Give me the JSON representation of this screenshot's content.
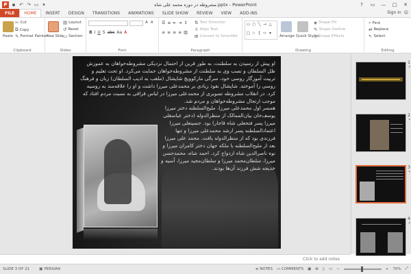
{
  "window": {
    "title": "مشروطه در دوره محمد علی شاه.pptx - PowerPoint",
    "controls": [
      "?",
      "▭",
      "—",
      "□",
      "✕"
    ]
  },
  "tabs": [
    "FILE",
    "HOME",
    "INSERT",
    "DESIGN",
    "TRANSITIONS",
    "ANIMATIONS",
    "SLIDE SHOW",
    "REVIEW",
    "VIEW",
    "ADD-INS"
  ],
  "active_tab": "HOME",
  "signin": "Sign in",
  "ribbon": {
    "clipboard": {
      "label": "Clipboard",
      "paste": "Paste",
      "cut": "Cut",
      "copy": "Copy",
      "format_painter": "Format Painter"
    },
    "slides": {
      "label": "Slides",
      "new_slide": "New Slide",
      "layout": "Layout",
      "reset": "Reset",
      "section": "Section"
    },
    "font": {
      "label": "Font",
      "bold": "B",
      "italic": "I",
      "underline": "U",
      "shadow": "S",
      "strike": "abc",
      "aa": "Aa",
      "font_color": "A"
    },
    "paragraph": {
      "label": "Paragraph",
      "text_direction": "Text Direction",
      "align_text": "Align Text",
      "smartart": "Convert to SmartArt"
    },
    "drawing": {
      "label": "Drawing",
      "arrange": "Arrange",
      "quick_styles": "Quick Styles",
      "shape_fill": "Shape Fill",
      "shape_outline": "Shape Outline",
      "shape_effects": "Shape Effects"
    },
    "editing": {
      "label": "Editing",
      "find": "Find",
      "replace": "Replace",
      "select": "Select"
    }
  },
  "slide": {
    "paragraphs": [
      "او پیش از رسیدن به سلطنت، به طور قرین از احتمال نزدیکی مشروطه‌خواهان به عموزش ظل السلطان و نصب وی به سلطنت از مشروطه‌خواهان حمایت می‌کرد. او تحت تعلیم و تربیت آموزگار روسی خود، سرگی مارکوویچ شاپشال (ملقب به ادیب السلطان) زبان و فرهنگ روسی را آموخته. شاپشال نفوذ زیادی بر محمدعلی میرزا داشت و او را علاقه‌مند به روسیه کرد. در انقلاب مشروطه تصویری از محمدعلی میرزا در لباس قزاقی به نسبت مردم افتاد که موجب ارتجال مشروطه‌خواهان و مردم شد.",
      "همسر اول محمدعلی میرزا، ملیح‌السلطنه دختر میرزا یوسف‌خان بیان‌الممالک از منظرالدوله (دختر عباسقلی میرزا پسر فتحعلی شاه قاجار) بود. حسینعلی میرزا اعتمادالسلطنه پسر ارشد محمدعلی میرزا و تنها فرزندی بود که از منظرالدوله یافت. محمد علی میرزا بعد از ملیح‌السلطنه با ملکه جهان دختر کامران میرزا و نوه ناصرالدین شاه ازدواج کرد. احمد شاه، محمدحسن میرزا، سلطان‌محمد میرزا و سلطان‌مجید میرزا، آسیه و خدیجه شش فرزند آن‌ها بودند."
    ]
  },
  "thumbnails": [
    {
      "num": "1",
      "star": "*"
    },
    {
      "num": "2",
      "star": "*"
    },
    {
      "num": "3",
      "star": "*"
    },
    {
      "num": "4",
      "star": "*"
    }
  ],
  "notes_placeholder": "Click to add notes",
  "status": {
    "slide": "SLIDE 3 OF 21",
    "language": "PERSIAN",
    "notes": "NOTES",
    "comments": "COMMENTS",
    "zoom": "70%"
  },
  "colors": {
    "accent": "#d24726",
    "selected_thumb": "#e16c3a"
  }
}
